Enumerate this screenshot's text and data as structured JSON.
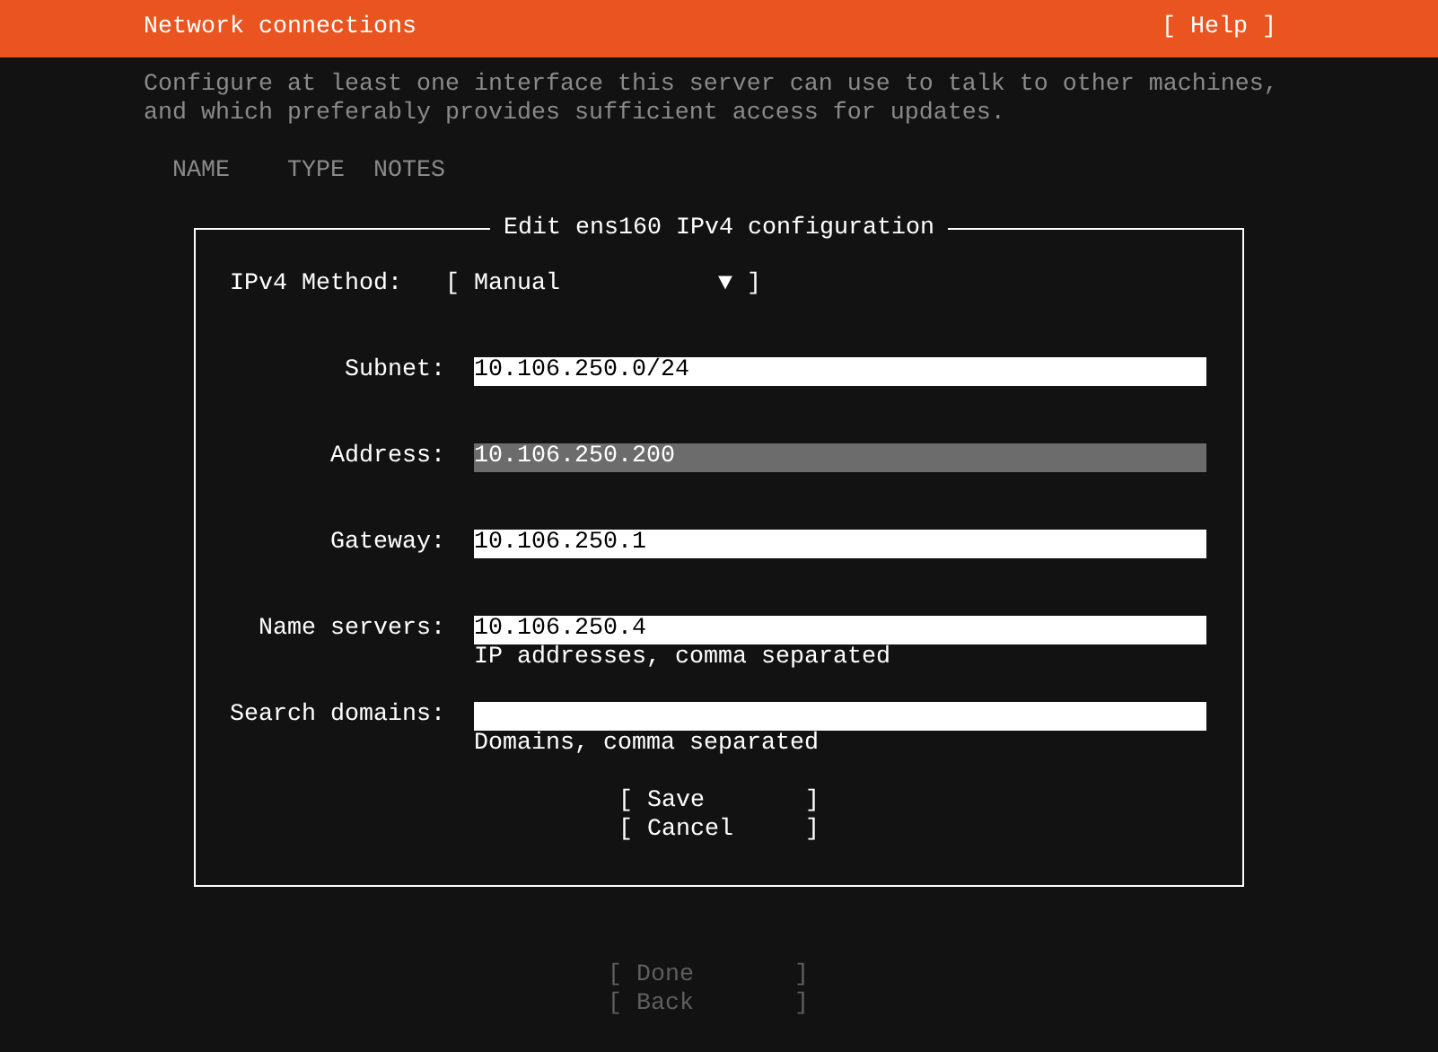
{
  "header": {
    "title": "Network connections",
    "help_button": "[ Help ]"
  },
  "description": "Configure at least one interface this server can use to talk to other machines, and which preferably provides sufficient access for updates.",
  "columns": [
    "NAME",
    "TYPE",
    "NOTES"
  ],
  "dialog": {
    "title": "Edit ens160 IPv4 configuration",
    "method": {
      "label": "IPv4 Method:",
      "value": "[ Manual           ▼ ]"
    },
    "fields": [
      {
        "label": "Subnet:",
        "value": "10.106.250.0/24",
        "focused": false
      },
      {
        "label": "Address:",
        "value": "10.106.250.200",
        "focused": true
      },
      {
        "label": "Gateway:",
        "value": "10.106.250.1",
        "focused": false
      },
      {
        "label": "Name servers:",
        "value": "10.106.250.4",
        "focused": false,
        "hint": "IP addresses, comma separated"
      },
      {
        "label": "Search domains:",
        "focused": false,
        "hint": "Domains, comma separated"
      }
    ],
    "buttons": [
      {
        "label": "[ Save       ]",
        "disabled": false
      },
      {
        "label": "[ Cancel     ]",
        "disabled": false
      }
    ]
  },
  "footer_buttons": [
    {
      "label": "[ Done       ]",
      "disabled": true
    },
    {
      "label": "[ Back       ]",
      "disabled": true
    }
  ]
}
